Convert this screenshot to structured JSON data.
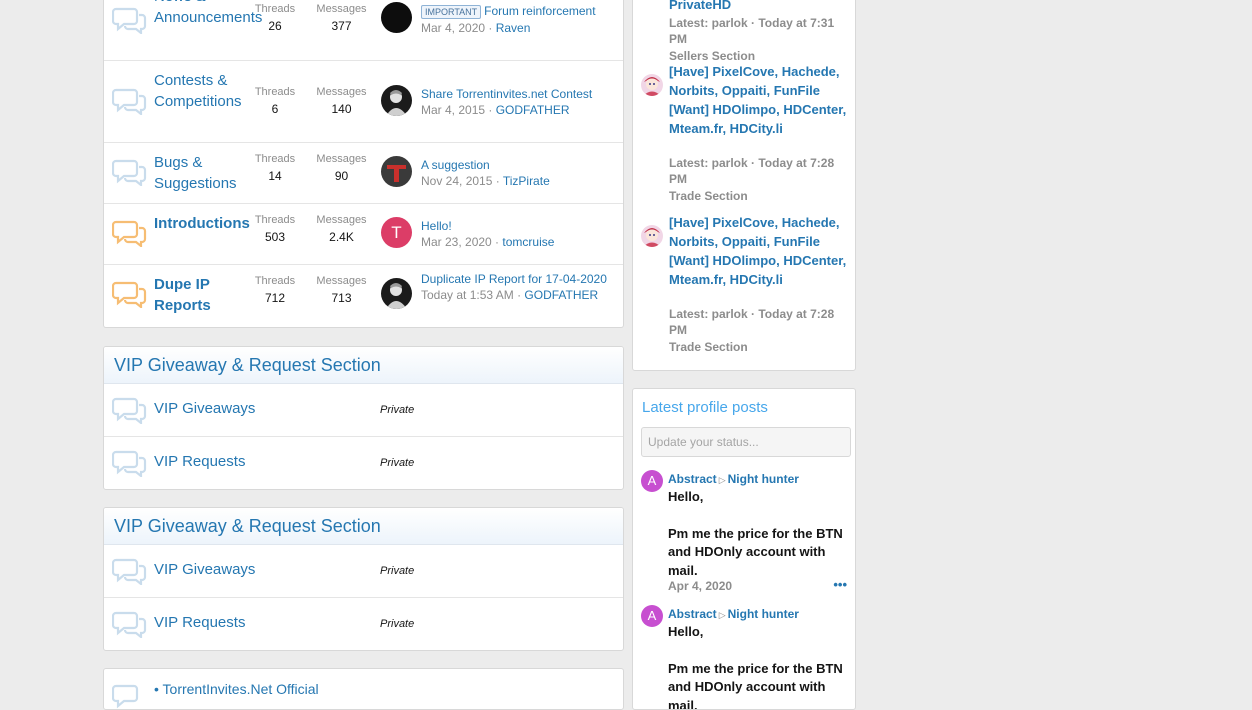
{
  "forums": [
    {
      "title": "News & Announcements",
      "bold": false,
      "icon": "read",
      "threads_label": "Threads",
      "threads": "26",
      "messages_label": "Messages",
      "messages": "377",
      "prefix": "IMPORTANT",
      "last_title": "Forum reinforcement",
      "last_date": "Mar 4, 2020",
      "last_user": "Raven",
      "avatar": "dark"
    },
    {
      "title": "Contests & Competitions",
      "bold": false,
      "icon": "read",
      "threads_label": "Threads",
      "threads": "6",
      "messages_label": "Messages",
      "messages": "140",
      "prefix": "",
      "last_title": "Share Torrentinvites.net Contest",
      "last_date": "Mar 4, 2015",
      "last_user": "GODFATHER",
      "avatar": "godfather"
    },
    {
      "title": "Bugs & Suggestions",
      "bold": false,
      "icon": "read",
      "threads_label": "Threads",
      "threads": "14",
      "messages_label": "Messages",
      "messages": "90",
      "prefix": "",
      "last_title": "A suggestion",
      "last_date": "Nov 24, 2015",
      "last_user": "TizPirate",
      "avatar": "pirate"
    },
    {
      "title": "Introductions",
      "bold": true,
      "icon": "unread",
      "threads_label": "Threads",
      "threads": "503",
      "messages_label": "Messages",
      "messages": "2.4K",
      "prefix": "",
      "last_title": "Hello!",
      "last_date": "Mar 23, 2020",
      "last_user": "tomcruise",
      "avatar": "letter",
      "avatar_letter": "T"
    },
    {
      "title": "Dupe IP Reports",
      "bold": true,
      "icon": "unread",
      "threads_label": "Threads",
      "threads": "712",
      "messages_label": "Messages",
      "messages": "713",
      "prefix": "",
      "last_title": "Duplicate IP Report for 17-04-2020",
      "last_date": "Today at 1:53 AM",
      "last_user": "GODFATHER",
      "avatar": "godfather"
    }
  ],
  "sections": [
    {
      "title": "VIP Giveaway & Request Section",
      "nodes": [
        {
          "title": "VIP Giveaways",
          "status": "Private"
        },
        {
          "title": "VIP Requests",
          "status": "Private"
        }
      ]
    },
    {
      "title": "VIP Giveaway & Request Section",
      "nodes": [
        {
          "title": "VIP Giveaways",
          "status": "Private"
        },
        {
          "title": "VIP Requests",
          "status": "Private"
        }
      ]
    }
  ],
  "partial_node": {
    "title": "• TorrentInvites.Net Official"
  },
  "sidebar_threads": {
    "top": {
      "title": "PrivateHD",
      "latest": "Latest: parlok · Today at 7:31 PM",
      "forum": "Sellers Section"
    },
    "items": [
      {
        "title": "[Have] PixelCove, Hachede, Norbits, Oppaiti, FunFile [Want] HDOlimpo, HDCenter, Mteam.fr, HDCity.li",
        "latest": "Latest: parlok · Today at 7:28 PM",
        "forum": "Trade Section"
      },
      {
        "title": "[Have] PixelCove, Hachede, Norbits, Oppaiti, FunFile [Want] HDOlimpo, HDCenter, Mteam.fr, HDCity.li",
        "latest": "Latest: parlok · Today at 7:28 PM",
        "forum": "Trade Section"
      }
    ]
  },
  "profile_posts": {
    "heading": "Latest profile posts",
    "status_placeholder": "Update your status...",
    "posts": [
      {
        "author": "Abstract",
        "arrow": "▷",
        "target": "Night hunter",
        "avatar_letter": "A",
        "line1": "Hello,",
        "line2": "Pm me the price for the BTN and HDOnly account with mail.",
        "date": "Apr 4, 2020",
        "more": "•••"
      },
      {
        "author": "Abstract",
        "arrow": "▷",
        "target": "Night hunter",
        "avatar_letter": "A",
        "line1": "Hello,",
        "line2": "Pm me the price for the BTN and HDOnly account with mail.",
        "date": "",
        "more": ""
      }
    ]
  },
  "colors": {
    "link": "#2577b1",
    "muted": "#8c8c8c",
    "read_icon": "#c9dcec",
    "unread_icon": "#f6bd73",
    "page_bg": "#ececec"
  }
}
